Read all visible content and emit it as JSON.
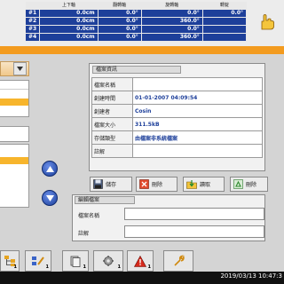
{
  "axis_table": {
    "headers": [
      "上下軸",
      "翻轉軸",
      "旋轉軸",
      "轉錠"
    ],
    "rows": [
      {
        "id": "#1",
        "values": [
          "0.0cm",
          "0.0°",
          "0.0°",
          "0.0°"
        ]
      },
      {
        "id": "#2",
        "values": [
          "0.0cm",
          "0.0°",
          "360.0°",
          ""
        ]
      },
      {
        "id": "#3",
        "values": [
          "0.0cm",
          "0.0°",
          "0.0°",
          ""
        ]
      },
      {
        "id": "#4",
        "values": [
          "0.0cm",
          "0.0°",
          "360.0°",
          ""
        ]
      }
    ]
  },
  "info_panel": {
    "title": "檔案資訊",
    "rows": [
      {
        "label": "檔案名稱",
        "value": ""
      },
      {
        "label": "創建時間",
        "value": "01-01-2007 04:09:54"
      },
      {
        "label": "創建者",
        "value": "Cosin"
      },
      {
        "label": "檔案大小",
        "value": "311.5kB"
      },
      {
        "label": "存儲類型",
        "value": "由檔案非系統檔案"
      },
      {
        "label": "註解",
        "value": ""
      }
    ]
  },
  "actions": {
    "save": "儲存",
    "delete_file": "刪除",
    "load": "讀取",
    "remove": "刪除"
  },
  "rename_panel": {
    "title": "編輯檔案",
    "name_label": "檔案名稱",
    "note_label": "註解"
  },
  "toolbar": {
    "badges": [
      "1",
      "1",
      "1",
      "1",
      "1"
    ]
  },
  "status": {
    "datetime": "2019/03/13 10:47:3"
  },
  "colors": {
    "accent_orange": "#f39b1f",
    "axis_blue": "#1d3f9a",
    "selection_yellow": "#f7b52c"
  }
}
